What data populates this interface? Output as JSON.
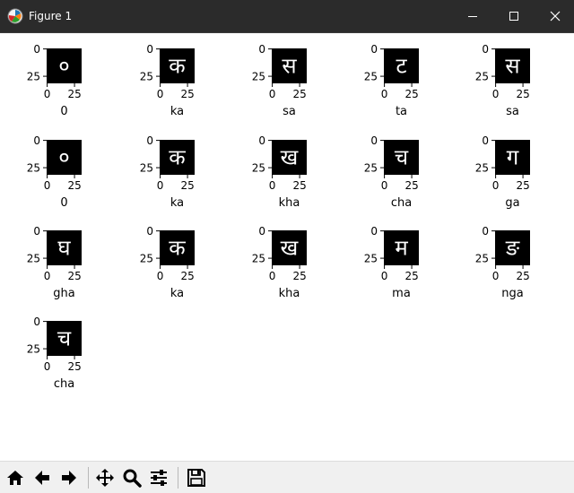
{
  "window": {
    "title": "Figure 1",
    "controls": [
      "minimize",
      "maximize",
      "close"
    ]
  },
  "figure": {
    "subplot_count": 16,
    "image_size": 32,
    "axis": {
      "y_ticks": [
        "0",
        "25"
      ],
      "x_ticks": [
        "0",
        "25"
      ]
    },
    "panels": [
      {
        "label": "0",
        "glyph": "०"
      },
      {
        "label": "ka",
        "glyph": "क"
      },
      {
        "label": "sa",
        "glyph": "स"
      },
      {
        "label": "ta",
        "glyph": "ट"
      },
      {
        "label": "sa",
        "glyph": "स"
      },
      {
        "label": "0",
        "glyph": "०"
      },
      {
        "label": "ka",
        "glyph": "क"
      },
      {
        "label": "kha",
        "glyph": "ख"
      },
      {
        "label": "cha",
        "glyph": "च"
      },
      {
        "label": "ga",
        "glyph": "ग"
      },
      {
        "label": "gha",
        "glyph": "घ"
      },
      {
        "label": "ka",
        "glyph": "क"
      },
      {
        "label": "kha",
        "glyph": "ख"
      },
      {
        "label": "ma",
        "glyph": "म"
      },
      {
        "label": "nga",
        "glyph": "ङ"
      },
      {
        "label": "cha",
        "glyph": "च"
      }
    ]
  },
  "toolbar": {
    "buttons": [
      {
        "name": "home",
        "icon": "home-icon",
        "tooltip": "Reset original view"
      },
      {
        "name": "back",
        "icon": "arrow-left-icon",
        "tooltip": "Back to previous view"
      },
      {
        "name": "forward",
        "icon": "arrow-right-icon",
        "tooltip": "Forward to next view"
      },
      {
        "name": "pan",
        "icon": "move-icon",
        "tooltip": "Pan axes"
      },
      {
        "name": "zoom",
        "icon": "magnifier-icon",
        "tooltip": "Zoom to rectangle"
      },
      {
        "name": "configure",
        "icon": "sliders-icon",
        "tooltip": "Configure subplots"
      },
      {
        "name": "save",
        "icon": "save-icon",
        "tooltip": "Save the figure"
      }
    ]
  },
  "colors": {
    "titlebar": "#2b2b2b",
    "title_text": "#ffffff",
    "image_bg": "#000000",
    "glyph": "#ffffff",
    "toolbar_bg": "#f0f0f0"
  }
}
